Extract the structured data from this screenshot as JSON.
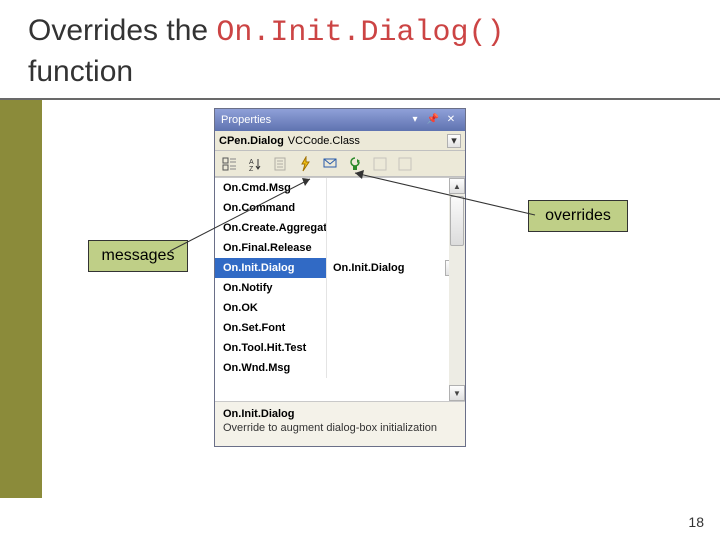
{
  "slide": {
    "title_prefix": "Overrides the ",
    "title_code": "On.Init.Dialog()",
    "title_suffix": "function"
  },
  "props_panel": {
    "title": "Properties",
    "class_name": "CPen.Dialog",
    "class_type": "VCCode.Class",
    "list_items": [
      "On.Cmd.Msg",
      "On.Command",
      "On.Create.Aggregat",
      "On.Final.Release",
      "On.Init.Dialog",
      "On.Notify",
      "On.OK",
      "On.Set.Font",
      "On.Tool.Hit.Test",
      "On.Wnd.Msg"
    ],
    "selected_index": 4,
    "selected_value": "On.Init.Dialog",
    "desc_heading": "On.Init.Dialog",
    "desc_text": "Override to augment dialog-box initialization"
  },
  "callouts": {
    "messages": "messages",
    "overrides": "overrides"
  },
  "page_number": "18"
}
